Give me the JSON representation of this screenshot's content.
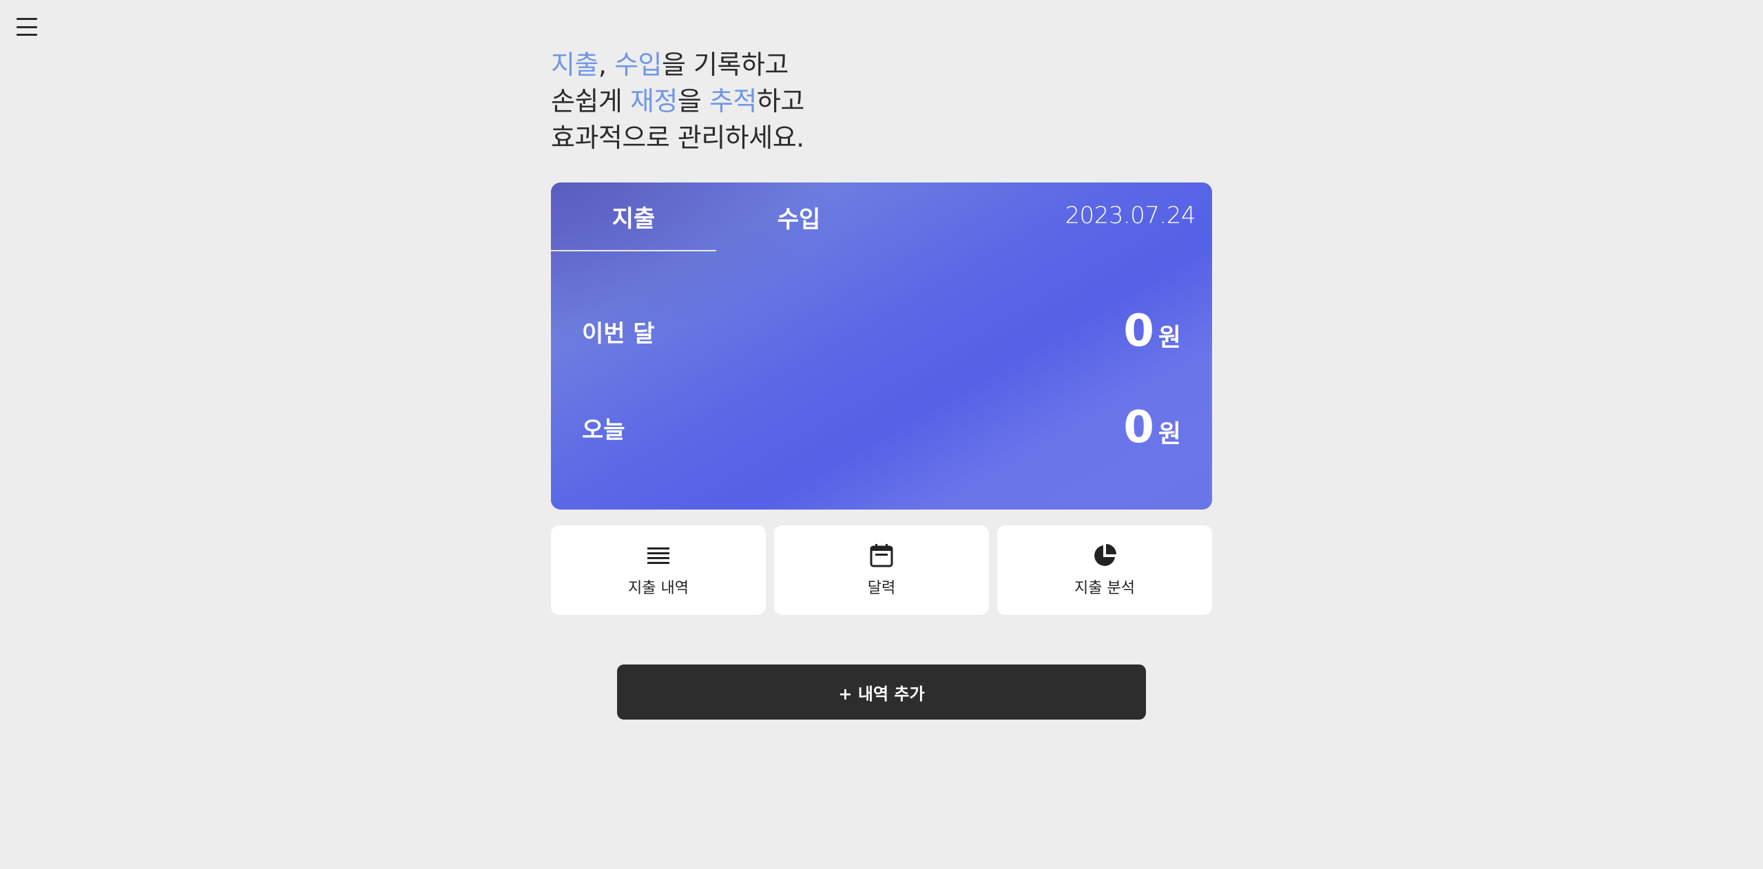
{
  "headline": {
    "line1": {
      "hl1": "지출",
      "sep": ", ",
      "hl2": "수입",
      "rest": "을 기록하고"
    },
    "line2": {
      "pre": "손쉽게 ",
      "hl1": "재정",
      "mid": "을 ",
      "hl2": "추적",
      "rest": "하고"
    },
    "line3": "효과적으로 관리하세요."
  },
  "card": {
    "tabs": [
      {
        "label": "지출",
        "active": true
      },
      {
        "label": "수입",
        "active": false
      }
    ],
    "date": "2023.07.24",
    "rows": [
      {
        "label": "이번 달",
        "amount": "0",
        "unit": "원"
      },
      {
        "label": "오늘",
        "amount": "0",
        "unit": "원"
      }
    ]
  },
  "quick_actions": [
    {
      "label": "지출 내역",
      "icon": "list-icon"
    },
    {
      "label": "달력",
      "icon": "calendar-icon"
    },
    {
      "label": "지출 분석",
      "icon": "pie-chart-icon"
    }
  ],
  "add_button": {
    "label": "+ 내역 추가"
  },
  "colors": {
    "highlight": "#6f97e6",
    "card_accent": "#5561e6",
    "button": "#2d2d2d",
    "background": "#ededed"
  }
}
